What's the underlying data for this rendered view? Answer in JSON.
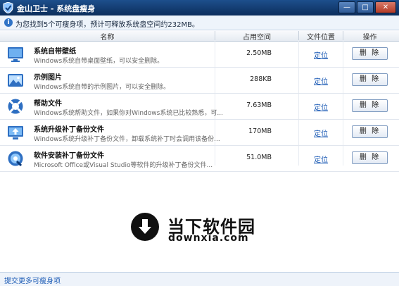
{
  "window": {
    "title": "金山卫士 - 系统盘瘦身",
    "min_glyph": "—",
    "max_glyph": "□",
    "close_glyph": "✕"
  },
  "info": {
    "icon": "i",
    "text": "为您找到5个可瘦身项，预计可释放系统盘空间约232MB。"
  },
  "table": {
    "headers": {
      "name": "名称",
      "size": "占用空间",
      "location": "文件位置",
      "action": "操作"
    },
    "rows": [
      {
        "name": "系统自带壁纸",
        "desc": "Windows系统自带桌面壁纸，可以安全删除。",
        "size": "2.50MB",
        "location": "定位",
        "action": "删 除",
        "icon": "wallpaper-icon"
      },
      {
        "name": "示例图片",
        "desc": "Windows系统自带的示例图片，可以安全删除。",
        "size": "288KB",
        "location": "定位",
        "action": "删 除",
        "icon": "picture-icon"
      },
      {
        "name": "帮助文件",
        "desc": "Windows系统帮助文件，如果你对Windows系统已比较熟悉，可...",
        "size": "7.63MB",
        "location": "定位",
        "action": "删 除",
        "icon": "lifebuoy-icon"
      },
      {
        "name": "系统升级补丁备份文件",
        "desc": "Windows系统升级补丁备份文件，卸载系统补丁时会调用该备份...",
        "size": "170MB",
        "location": "定位",
        "action": "删 除",
        "icon": "upgrade-icon"
      },
      {
        "name": "软件安装补丁备份文件",
        "desc": "Microsoft Office或Visual Studio等软件的升级补丁备份文件...",
        "size": "51.0MB",
        "location": "定位",
        "action": "删 除",
        "icon": "disc-icon"
      }
    ]
  },
  "watermark": {
    "title": "当下软件园",
    "subtitle": "downxia.com"
  },
  "footer": {
    "link": "提交更多可瘦身项"
  }
}
